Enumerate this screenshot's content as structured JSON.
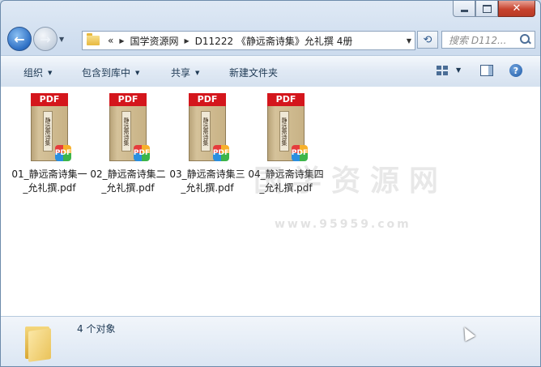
{
  "window": {
    "minimize_label": "minimize",
    "maximize_label": "maximize",
    "close_glyph": "✕"
  },
  "address": {
    "overflow": "«",
    "crumbs": [
      "国学资源网",
      "D11222 《静远斋诗集》允礼撰 4册"
    ]
  },
  "search": {
    "placeholder": "搜索 D112..."
  },
  "toolbar": {
    "organize": "组织",
    "include_library": "包含到库中",
    "share": "共享",
    "new_folder": "新建文件夹"
  },
  "files": [
    {
      "name": "01_静远斋诗集一_允礼撰.pdf",
      "badge": "PDF",
      "cover": "静远斋诗集"
    },
    {
      "name": "02_静远斋诗集二_允礼撰.pdf",
      "badge": "PDF",
      "cover": "静远斋诗集"
    },
    {
      "name": "03_静远斋诗集三_允礼撰.pdf",
      "badge": "PDF",
      "cover": "静远斋诗集"
    },
    {
      "name": "04_静远斋诗集四_允礼撰.pdf",
      "badge": "PDF",
      "cover": "静远斋诗集"
    }
  ],
  "watermark": {
    "text": "国学资源网",
    "url": "www.95959.com"
  },
  "details": {
    "count": "4 个对象"
  },
  "colors": {
    "accent": "#2d6fc4",
    "pdf_red": "#d4161c"
  }
}
